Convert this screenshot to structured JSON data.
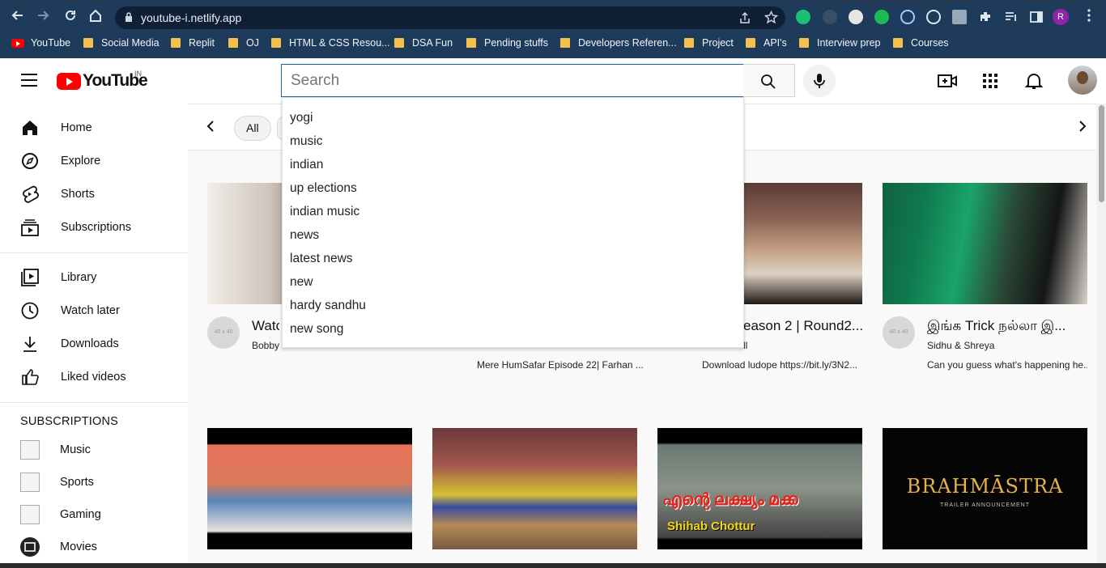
{
  "browser": {
    "url": "youtube-i.netlify.app",
    "profile_initial": "R",
    "bookmarks": [
      {
        "label": "YouTube",
        "type": "youtube"
      },
      {
        "label": "Social Media",
        "type": "folder"
      },
      {
        "label": "Replit",
        "type": "folder"
      },
      {
        "label": "OJ",
        "type": "folder"
      },
      {
        "label": "HTML & CSS Resou...",
        "type": "folder"
      },
      {
        "label": "DSA Fun",
        "type": "folder"
      },
      {
        "label": "Pending stuffs",
        "type": "folder"
      },
      {
        "label": "Developers Referen...",
        "type": "folder"
      },
      {
        "label": "Project",
        "type": "folder"
      },
      {
        "label": "API's",
        "type": "folder"
      },
      {
        "label": "Interview prep",
        "type": "folder"
      },
      {
        "label": "Courses",
        "type": "folder"
      }
    ]
  },
  "header": {
    "logo_text": "YouTube",
    "country": "IN",
    "search_placeholder": "Search"
  },
  "sidebar": {
    "main": [
      {
        "label": "Home",
        "icon": "home-icon"
      },
      {
        "label": "Explore",
        "icon": "compass-icon"
      },
      {
        "label": "Shorts",
        "icon": "shorts-icon"
      },
      {
        "label": "Subscriptions",
        "icon": "subscriptions-icon"
      }
    ],
    "library": [
      {
        "label": "Library",
        "icon": "library-icon"
      },
      {
        "label": "Watch later",
        "icon": "clock-icon"
      },
      {
        "label": "Downloads",
        "icon": "download-icon"
      },
      {
        "label": "Liked videos",
        "icon": "thumbs-up-icon"
      }
    ],
    "subscriptions_title": "SUBSCRIPTIONS",
    "subscriptions": [
      {
        "label": "Music"
      },
      {
        "label": "Sports"
      },
      {
        "label": "Gaming"
      },
      {
        "label": "Movies"
      }
    ]
  },
  "chips": {
    "items": [
      "All"
    ]
  },
  "suggestions": [
    "yogi",
    "music",
    "indian",
    "up elections",
    "indian music",
    "news",
    "latest news",
    "new",
    "hardy sandhu",
    "new song"
  ],
  "videos": [
    {
      "title": "Watc",
      "channel": "Bobby",
      "desc": "",
      "avatar": "40 x 40"
    },
    {
      "title": "",
      "channel": "",
      "desc": "Mere HumSafar Episode 22| Farhan ...",
      "avatar": ""
    },
    {
      "title": "eason 2 | Round2...",
      "channel": "ll",
      "desc": "Download ludope https://bit.ly/3N2...",
      "avatar": ""
    },
    {
      "title": "இங்க Trick நல்லா இ...",
      "channel": "Sidhu & Shreya",
      "desc": "Can you guess what's happening he...",
      "avatar": "40 x 40"
    }
  ],
  "thumb_texts": {
    "row2_c": "എന്റെ ലക്ഷ്യം മക്ക",
    "row2_c_sub": "Shihab Chottur",
    "row2_d": "BRAHMĀSTRA",
    "row2_d_sub": "TRAILER ANNOUNCEMENT"
  },
  "colors": {
    "brand_red": "#ff0000",
    "search_border": "#1c62b9",
    "browser_bg": "#1f3b5c"
  }
}
